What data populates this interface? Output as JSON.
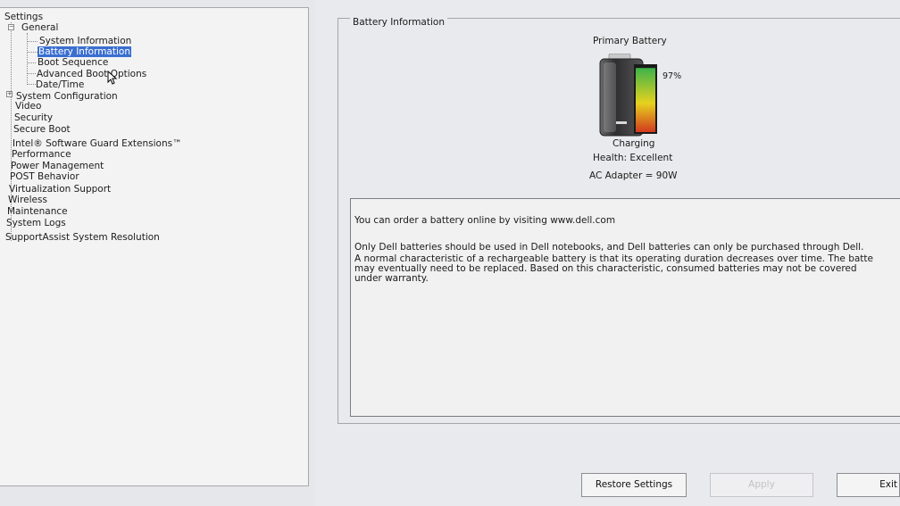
{
  "tree": {
    "root": "Settings",
    "items": [
      {
        "label": "General",
        "level": 1
      },
      {
        "label": "System Information",
        "level": 2
      },
      {
        "label": "Battery Information",
        "level": 2,
        "selected": true
      },
      {
        "label": "Boot Sequence",
        "level": 2
      },
      {
        "label": "Advanced Boot Options",
        "level": 2
      },
      {
        "label": "Date/Time",
        "level": 2
      },
      {
        "label": "System Configuration",
        "level": 1
      },
      {
        "label": "Video",
        "level": 1
      },
      {
        "label": "Security",
        "level": 1
      },
      {
        "label": "Secure Boot",
        "level": 1
      },
      {
        "label": "Intel® Software Guard Extensions™",
        "level": 1
      },
      {
        "label": "Performance",
        "level": 1
      },
      {
        "label": "Power Management",
        "level": 1
      },
      {
        "label": "POST Behavior",
        "level": 1
      },
      {
        "label": "Virtualization Support",
        "level": 1
      },
      {
        "label": "Wireless",
        "level": 1
      },
      {
        "label": "Maintenance",
        "level": 1
      },
      {
        "label": "System Logs",
        "level": 1
      },
      {
        "label": "SupportAssist System Resolution",
        "level": 1
      }
    ]
  },
  "battery": {
    "group_title": "Battery Information",
    "heading": "Primary Battery",
    "percent_label": "97%",
    "charge_level": 0.97,
    "status": "Charging",
    "health": "Health: Excellent",
    "adapter": "AC Adapter = 90W",
    "colors": {
      "fill_green": "#3cb34a",
      "fill_yellow": "#e6d21e",
      "fill_red": "#d23a1e",
      "body": "#3b3b3d"
    }
  },
  "info": {
    "para1": "You can order a battery online by visiting www.dell.com",
    "para2": "Only Dell batteries should be used in Dell notebooks, and Dell batteries can only be purchased through Dell.",
    "para3": "A normal characteristic of a rechargeable battery is that its operating duration decreases over time.  The batte\nmay eventually need to be replaced.  Based on this characteristic, consumed batteries may not be covered\nunder warranty."
  },
  "buttons": {
    "restore": "Restore Settings",
    "apply": "Apply",
    "exit": "Exit"
  }
}
